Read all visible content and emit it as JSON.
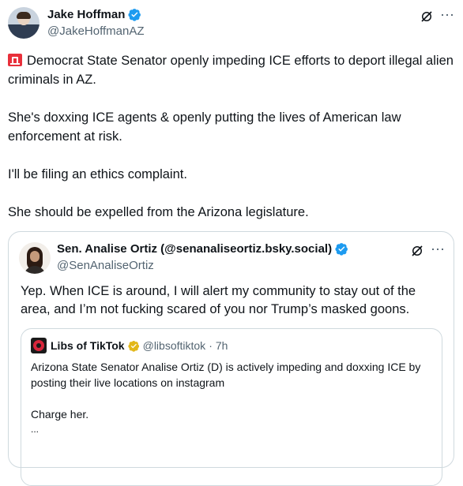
{
  "tweet": {
    "author_name": "Jake Hoffman",
    "author_handle": "@JakeHoffmanAZ",
    "more_icon": "⋯",
    "lines": [
      "Democrat State Senator openly impeding ICE efforts to deport illegal alien criminals in AZ.",
      "She's doxxing ICE agents & openly putting the lives of American law enforcement at risk.",
      "I'll be filing an ethics complaint.",
      "She should be expelled from the Arizona legislature."
    ]
  },
  "quote": {
    "author_name": "Sen. Analise Ortiz (@senanaliseortiz.bsky.social)",
    "author_handle": "@SenAnaliseOrtiz",
    "more_icon": "⋯",
    "text": "Yep. When ICE is around, I will alert my community to stay out of the area, and I’m not fucking scared of you nor Trump’s masked goons."
  },
  "nested_quote": {
    "author_name": "Libs of TikTok",
    "author_handle": "@libsoftiktok",
    "separator": "·",
    "time": "7h",
    "lines": [
      "Arizona State Senator Analise Ortiz (D) is actively impeding and doxxing ICE by posting their live locations on instagram",
      "Charge her."
    ],
    "ellipsis": "..."
  },
  "colors": {
    "verified_blue": "#1d9bf0",
    "verified_gold": "#e2b719",
    "text": "#0f1419",
    "secondary": "#536471",
    "border": "#cfd9de"
  }
}
